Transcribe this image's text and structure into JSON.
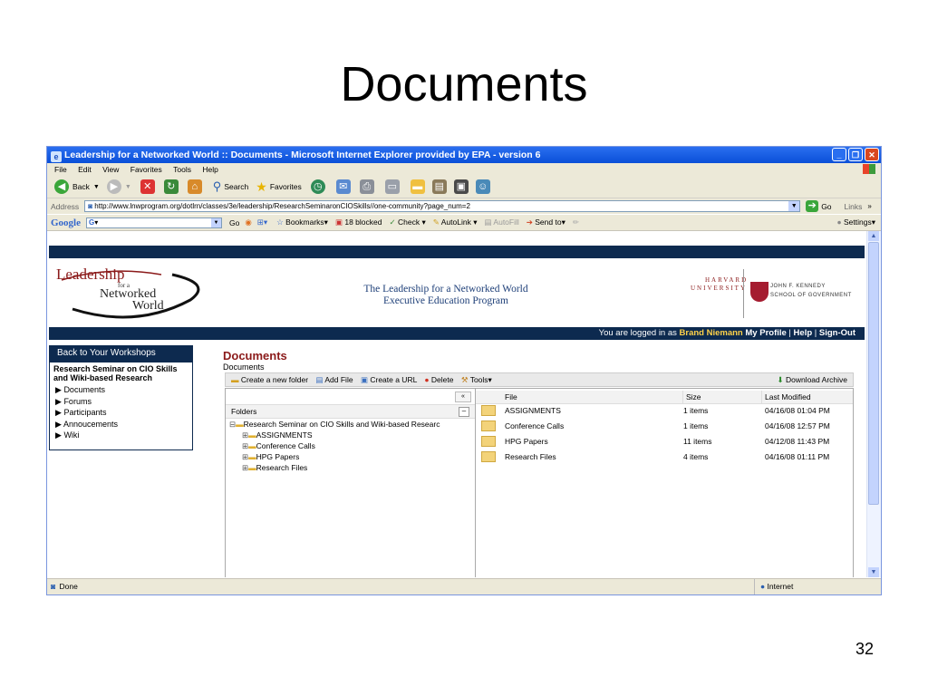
{
  "slide": {
    "title": "Documents",
    "page_number": "32"
  },
  "window": {
    "title": "Leadership for a Networked World :: Documents - Microsoft Internet Explorer provided by EPA - version 6"
  },
  "menu": [
    "File",
    "Edit",
    "View",
    "Favorites",
    "Tools",
    "Help"
  ],
  "toolbar": {
    "back": "Back",
    "search": "Search",
    "favorites": "Favorites"
  },
  "address": {
    "label": "Address",
    "url": "http://www.lnwprogram.org/dotlrn/classes/3e/leadership/ResearchSeminaronCIOSkills//one-community?page_num=2",
    "go": "Go",
    "links": "Links"
  },
  "google_bar": {
    "brand": "Google",
    "g_label": "G",
    "go": "Go",
    "bookmarks": "Bookmarks",
    "blocked": "18 blocked",
    "check": "Check",
    "autolink": "AutoLink",
    "autofill": "AutoFill",
    "sendto": "Send to",
    "settings": "Settings"
  },
  "site": {
    "logo": {
      "line1": "Leadership",
      "line2": "for a",
      "line3": "Networked",
      "line4": "World"
    },
    "program": {
      "line1": "The Leadership for a Networked World",
      "line2": "Executive Education Program"
    },
    "harvard": {
      "line1": "HARVARD",
      "line2": "UNIVERSITY",
      "ksg1": "JOHN F. KENNEDY",
      "ksg2": "SCHOOL OF GOVERNMENT"
    },
    "login": {
      "prefix": "You are logged in as",
      "user": "Brand Niemann",
      "profile": "My Profile",
      "help": "Help",
      "signout": "Sign-Out"
    }
  },
  "leftnav": {
    "header": "Back to Your Workshops",
    "course": "Research Seminar on CIO Skills and Wiki-based Research",
    "items": [
      "Documents",
      "Forums",
      "Participants",
      "Annoucements",
      "Wiki"
    ]
  },
  "docs": {
    "heading": "Documents",
    "breadcrumb": "Documents",
    "actions": {
      "new_folder": "Create a new folder",
      "add_file": "Add File",
      "create_url": "Create a URL",
      "delete": "Delete",
      "tools": "Tools",
      "download": "Download Archive"
    },
    "folders_label": "Folders",
    "tree_root": "Research Seminar on CIO Skills and Wiki-based Researc",
    "tree_children": [
      "ASSIGNMENTS",
      "Conference Calls",
      "HPG Papers",
      "Research Files"
    ],
    "columns": [
      "File",
      "Size",
      "Last Modified"
    ],
    "rows": [
      {
        "file": "ASSIGNMENTS",
        "size": "1 items",
        "modified": "04/16/08 01:04 PM"
      },
      {
        "file": "Conference Calls",
        "size": "1 items",
        "modified": "04/16/08 12:57 PM"
      },
      {
        "file": "HPG Papers",
        "size": "11 items",
        "modified": "04/12/08 11:43 PM"
      },
      {
        "file": "Research Files",
        "size": "4 items",
        "modified": "04/16/08 01:11 PM"
      }
    ]
  },
  "status": {
    "left": "Done",
    "zone": "Internet"
  }
}
